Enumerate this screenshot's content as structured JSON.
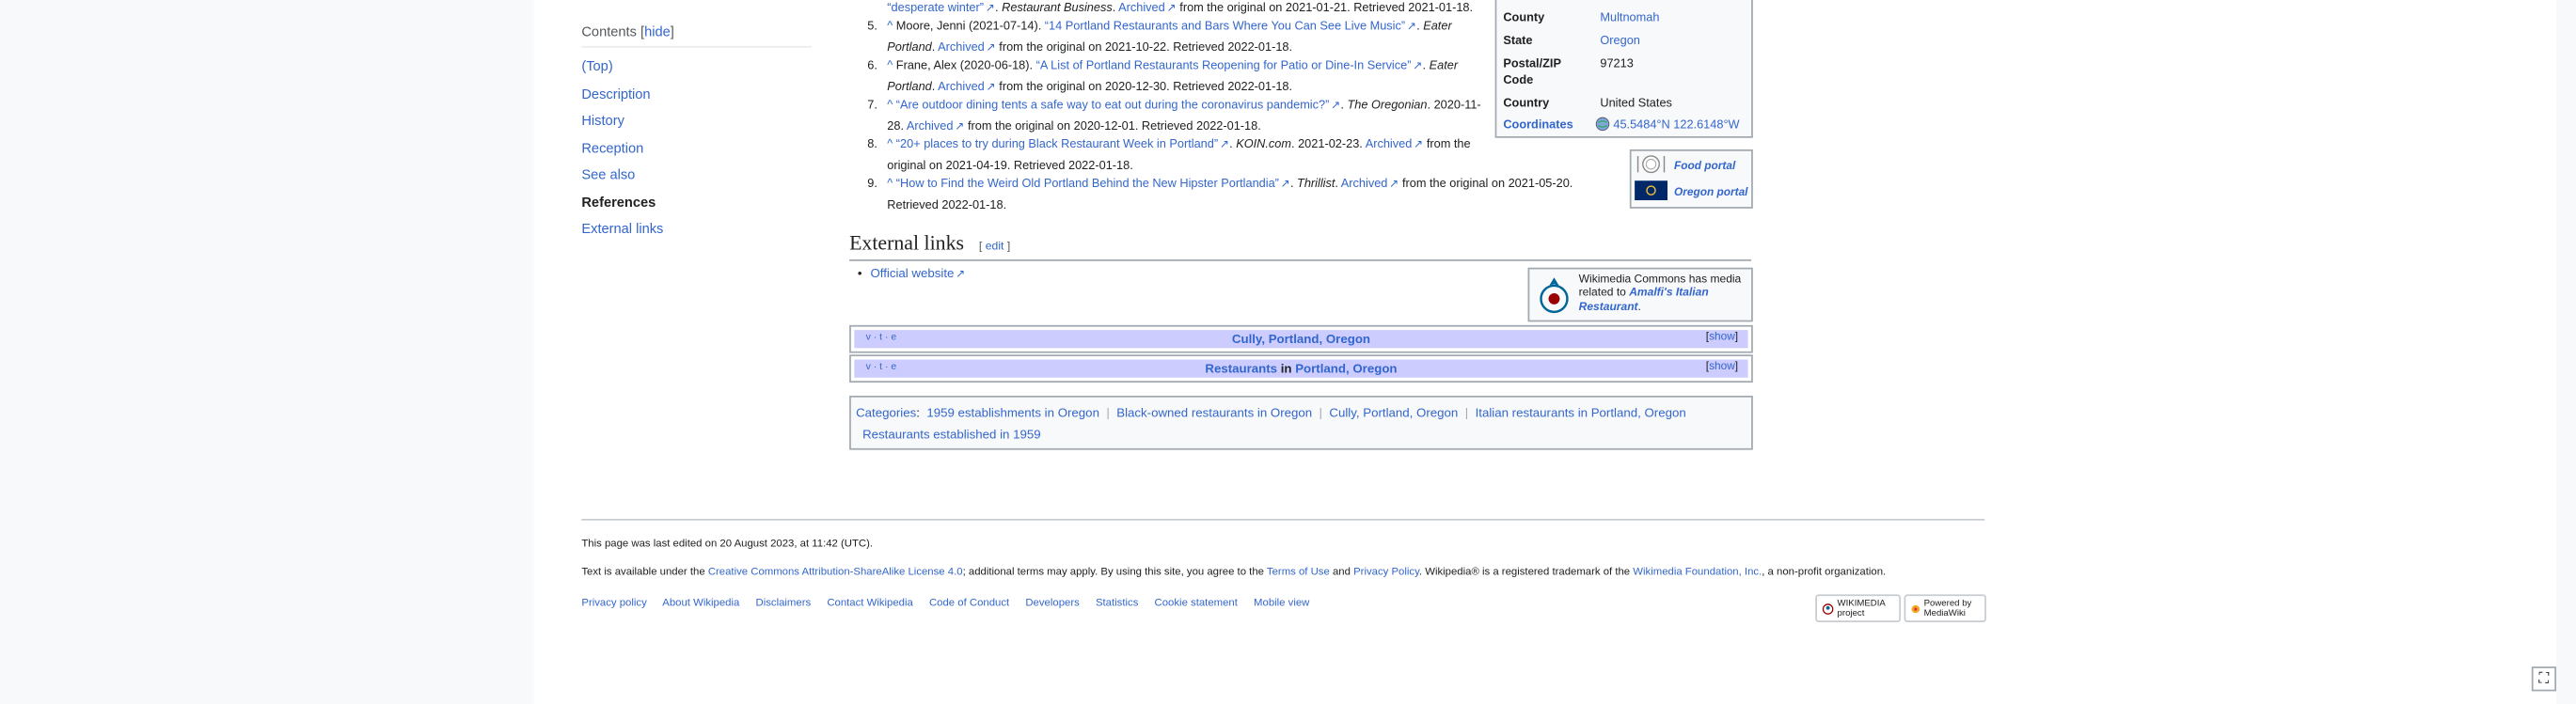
{
  "toc": {
    "heading": "Contents",
    "hide": "hide",
    "items": [
      "(Top)",
      "Description",
      "History",
      "Reception",
      "See also",
      "References",
      "External links"
    ]
  },
  "refs": [
    {
      "num": "",
      "l1": [
        [
          "“desperate winter”",
          "l"
        ],
        [
          ". ",
          "t"
        ],
        [
          "Restaurant Business",
          "i"
        ],
        [
          ". ",
          "t"
        ],
        [
          "Archived",
          "l"
        ],
        [
          " from the original on 2021-01-21. Retrieved 2021-01-18.",
          "t"
        ]
      ]
    },
    {
      "num": "5.",
      "l1": [
        [
          "^ ",
          "t"
        ],
        [
          "Moore, Jenni (2021-07-14). ",
          "t"
        ],
        [
          "“14 Portland Restaurants and Bars Where You Can See Live Music”",
          "l"
        ],
        [
          ". ",
          "t"
        ],
        [
          "Eater",
          "i"
        ]
      ],
      "l2": [
        [
          "Portland",
          "i"
        ],
        [
          ". ",
          "t"
        ],
        [
          "Archived",
          "l"
        ],
        [
          " from the original on 2021-10-22. Retrieved 2022-01-18.",
          "t"
        ]
      ]
    },
    {
      "num": "6.",
      "l1": [
        [
          "^ ",
          "t"
        ],
        [
          "Frane, Alex (2020-06-18). ",
          "t"
        ],
        [
          "“A List of Portland Restaurants Reopening for Patio or Dine-In Service”",
          "l"
        ],
        [
          ". ",
          "t"
        ],
        [
          "Eater",
          "i"
        ]
      ],
      "l2": [
        [
          "Portland",
          "i"
        ],
        [
          ". ",
          "t"
        ],
        [
          "Archived",
          "l"
        ],
        [
          " from the original on 2020-12-30. Retrieved 2022-01-18.",
          "t"
        ]
      ]
    },
    {
      "num": "7.",
      "l1": [
        [
          "^ ",
          "t"
        ],
        [
          "“Are outdoor dining tents a safe way to eat out during the coronavirus pandemic?”",
          "l"
        ],
        [
          ". ",
          "t"
        ],
        [
          "The Oregonian",
          "i"
        ],
        [
          ". 2020-11-",
          "t"
        ]
      ],
      "l2": [
        [
          "28. ",
          "t"
        ],
        [
          "Archived",
          "l"
        ],
        [
          " from the original on 2020-12-01. Retrieved 2022-01-18.",
          "t"
        ]
      ]
    },
    {
      "num": "8.",
      "l1": [
        [
          "^ ",
          "t"
        ],
        [
          "“20+ places to try during Black Restaurant Week in Portland”",
          "l"
        ],
        [
          ". ",
          "t"
        ],
        [
          "KOIN.com",
          "i"
        ],
        [
          ". 2021-02-23. ",
          "t"
        ],
        [
          "Archived",
          "l"
        ],
        [
          " from the",
          "t"
        ]
      ],
      "l2": [
        [
          "original on 2021-04-19. Retrieved 2022-01-18.",
          "t"
        ]
      ]
    },
    {
      "num": "9.",
      "l1": [
        [
          "^ ",
          "t"
        ],
        [
          "“How to Find the Weird Old Portland Behind the New Hipster Portlandia”",
          "l"
        ],
        [
          ". ",
          "t"
        ],
        [
          "Thrillist",
          "i"
        ],
        [
          ". ",
          "t"
        ],
        [
          "Archived",
          "l"
        ],
        [
          " from the original on 2021-05-20.",
          "t"
        ]
      ],
      "l2": [
        [
          "Retrieved 2022-01-18.",
          "t"
        ]
      ]
    }
  ],
  "infobox": {
    "county_label": "County",
    "county": "Multnomah",
    "state_label": "State",
    "state": "Oregon",
    "zip_label": "Postal/ZIP Code",
    "zip": "97213",
    "country_label": "Country",
    "country": "United States",
    "coords_label": "Coordinates",
    "coords": "45.5484°N 122.6148°W"
  },
  "portals": {
    "food": "Food portal",
    "oregon": "Oregon portal"
  },
  "external_links": {
    "heading": "External links",
    "edit": "edit",
    "official": "Official website",
    "commons_line1": "Wikimedia Commons has media related to ",
    "commons_link": "Amalfi's Italian Restaurant",
    "commons_end": "."
  },
  "navboxes": [
    {
      "vte": "v · t · e",
      "title": "Cully, Portland, Oregon",
      "show": "show"
    },
    {
      "vte": "v · t · e",
      "title_a": "Restaurants",
      "title_mid": " in ",
      "title_b": "Portland, Oregon",
      "show": "show"
    }
  ],
  "categories": {
    "label": "Categories",
    "items": [
      "1959 establishments in Oregon",
      "Black-owned restaurants in Oregon",
      "Cully, Portland, Oregon",
      "Italian restaurants in Portland, Oregon",
      "Restaurants established in 1959"
    ]
  },
  "footer": {
    "last_edited": "This page was last edited on 20 August 2023, at 11:42 (UTC).",
    "license_pre": "Text is available under the ",
    "license_link": "Creative Commons Attribution-ShareAlike License 4.0",
    "license_mid": "; additional terms may apply. By using this site, you agree to the ",
    "terms": "Terms of Use",
    "and": " and ",
    "privacy": "Privacy Policy",
    "tm": ". Wikipedia® is a registered trademark of the ",
    "wmf": "Wikimedia Foundation, Inc.",
    "nonprofit": ", a non-profit organization.",
    "links": [
      "Privacy policy",
      "About Wikipedia",
      "Disclaimers",
      "Contact Wikipedia",
      "Code of Conduct",
      "Developers",
      "Statistics",
      "Cookie statement",
      "Mobile view"
    ],
    "badge_wm": "WIKIMEDIA project",
    "badge_mw": "Powered by MediaWiki"
  },
  "icons": {
    "fullscreen": "expand-icon"
  }
}
